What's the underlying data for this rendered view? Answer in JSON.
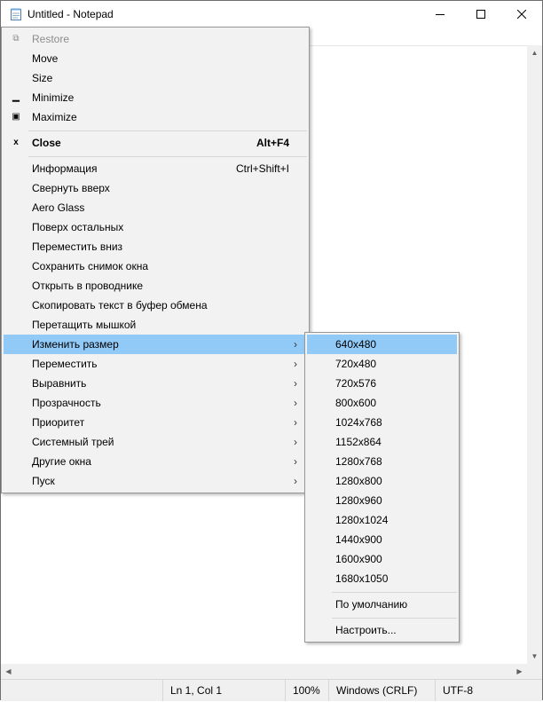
{
  "window": {
    "title": "Untitled - Notepad",
    "minimize_glyph": "—",
    "maximize_glyph": "□",
    "close_glyph": "✕"
  },
  "system_menu": {
    "restore": "Restore",
    "move": "Move",
    "size": "Size",
    "minimize": "Minimize",
    "maximize": "Maximize",
    "close": "Close",
    "close_shortcut": "Alt+F4",
    "info": "Информация",
    "info_shortcut": "Ctrl+Shift+I",
    "items": [
      "Свернуть вверх",
      "Aero Glass",
      "Поверх остальных",
      "Переместить вниз",
      "Сохранить снимок окна",
      "Открыть в проводнике",
      "Скопировать текст в буфер обмена",
      "Перетащить мышкой"
    ],
    "submenu_items": [
      "Изменить размер",
      "Переместить",
      "Выравнить",
      "Прозрачность",
      "Приоритет",
      "Системный трей",
      "Другие окна",
      "Пуск"
    ],
    "submenu_arrow": "›"
  },
  "resize_submenu": {
    "sizes": [
      "640x480",
      "720x480",
      "720x576",
      "800x600",
      "1024x768",
      "1152x864",
      "1280x768",
      "1280x800",
      "1280x960",
      "1280x1024",
      "1440x900",
      "1600x900",
      "1680x1050"
    ],
    "default": "По умолчанию",
    "customize": "Настроить..."
  },
  "status_bar": {
    "position": "Ln 1, Col 1",
    "zoom": "100%",
    "line_endings": "Windows (CRLF)",
    "encoding": "UTF-8"
  },
  "colors": {
    "highlight": "#91c9f7",
    "menu_bg": "#f2f2f2",
    "disabled_text": "#8c8c8c"
  }
}
